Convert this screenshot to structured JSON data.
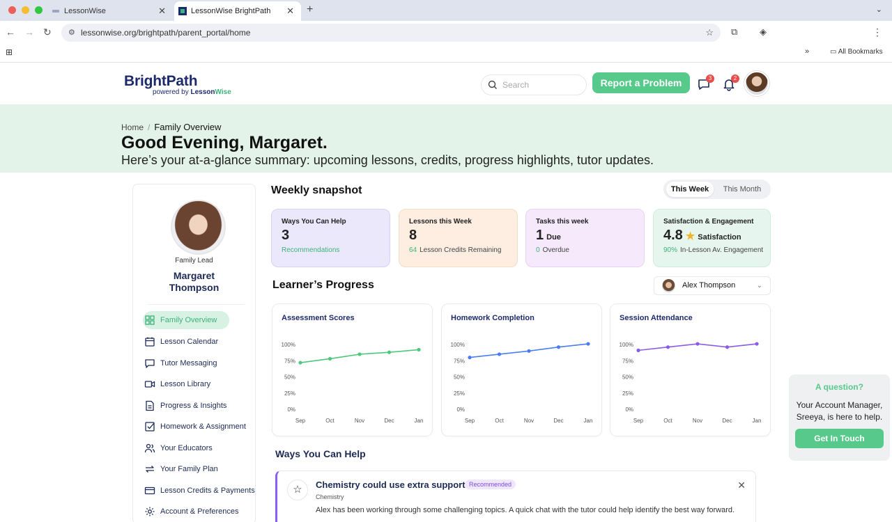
{
  "browser": {
    "tabs": [
      {
        "label": "LessonWise"
      },
      {
        "label": "LessonWise BrightPath"
      }
    ],
    "url": "lessonwise.org/brightpath/parent_portal/home",
    "all_bookmarks": "All Bookmarks"
  },
  "header": {
    "logo_main": "BrightPath",
    "logo_powered": "powered by",
    "logo_lesson": "Lesson",
    "logo_wise": "Wise",
    "search_placeholder": "Search",
    "report_button": "Report a Problem",
    "messages_badge": "3",
    "notifications_badge": "2"
  },
  "hero": {
    "breadcrumb_home": "Home",
    "breadcrumb_sep": "/",
    "breadcrumb_current": "Family Overview",
    "greeting": "Good Evening, Margaret.",
    "subtitle": "Here’s your at-a-glance summary: upcoming lessons, credits, progress highlights, tutor updates."
  },
  "sidebar": {
    "role": "Family Lead",
    "name_first": "Margaret",
    "name_last": "Thompson",
    "items": [
      {
        "label": "Family Overview",
        "icon": "grid-icon",
        "active": true
      },
      {
        "label": "Lesson Calendar",
        "icon": "calendar-icon"
      },
      {
        "label": "Tutor Messaging",
        "icon": "chat-icon"
      },
      {
        "label": "Lesson Library",
        "icon": "video-icon"
      },
      {
        "label": "Progress & Insights",
        "icon": "document-icon"
      },
      {
        "label": "Homework & Assignment",
        "icon": "checkbox-icon"
      },
      {
        "label": "Your Educators",
        "icon": "people-icon"
      },
      {
        "label": "Your Family Plan",
        "icon": "repeat-icon"
      },
      {
        "label": "Lesson Credits & Payments",
        "icon": "card-icon"
      },
      {
        "label": "Account & Preferences",
        "icon": "gear-icon"
      }
    ]
  },
  "snapshot": {
    "title": "Weekly snapshot",
    "toggle_week": "This Week",
    "toggle_month": "This Month",
    "cards": [
      {
        "label": "Ways You Can Help",
        "value": "3",
        "suffix": "",
        "foot_green": "Recommendations",
        "foot": "",
        "bg": "#ebe8fb",
        "border": "#d8d1f5"
      },
      {
        "label": "Lessons this Week",
        "value": "8",
        "suffix": "",
        "foot_green": "64",
        "foot": "Lesson Credits Remaining",
        "bg": "#fdeee1",
        "border": "#f6dcc5"
      },
      {
        "label": "Tasks this week",
        "value": "1",
        "suffix": "Due",
        "foot_green": "0",
        "foot": "Overdue",
        "bg": "#f6e9fb",
        "border": "#ead2f3"
      },
      {
        "label": "Satisfaction & Engagement",
        "value": "4.8",
        "suffix": "Satisfaction",
        "foot_green": "90%",
        "foot": "In-Lesson Av. Engagement",
        "bg": "#e6f6ee",
        "border": "#cdeedc"
      }
    ]
  },
  "progress": {
    "title": "Learner’s Progress",
    "learner": "Alex Thompson"
  },
  "chart_data": [
    {
      "type": "line",
      "title": "Assessment Scores",
      "categories": [
        "Sep",
        "Oct",
        "Nov",
        "Dec",
        "Jan"
      ],
      "values": [
        72,
        78,
        85,
        88,
        92
      ],
      "ylim": [
        0,
        100
      ],
      "yticks": [
        "0%",
        "25%",
        "50%",
        "75%",
        "100%"
      ],
      "color": "#4cc97a"
    },
    {
      "type": "line",
      "title": "Homework Completion",
      "categories": [
        "Sep",
        "Oct",
        "Nov",
        "Dec",
        "Jan"
      ],
      "values": [
        80,
        85,
        90,
        96,
        101
      ],
      "ylim": [
        0,
        100
      ],
      "yticks": [
        "0%",
        "25%",
        "50%",
        "75%",
        "100%"
      ],
      "color": "#4a7df0"
    },
    {
      "type": "line",
      "title": "Session Attendance",
      "categories": [
        "Sep",
        "Oct",
        "Nov",
        "Dec",
        "Jan"
      ],
      "values": [
        91,
        96,
        101,
        96,
        101
      ],
      "ylim": [
        0,
        100
      ],
      "yticks": [
        "0%",
        "25%",
        "50%",
        "75%",
        "100%"
      ],
      "color": "#8a5be6"
    }
  ],
  "help": {
    "section_title": "Ways You Can Help",
    "item_title": "Chemistry could use extra support",
    "item_tag": "Recommended",
    "item_subject": "Chemistry",
    "item_body": "Alex has been working through some challenging topics. A quick chat with the tutor could help identify the best way forward."
  },
  "floating_help": {
    "question": "A question?",
    "text": "Your Account Manager, Sreeya, is here to help.",
    "button": "Get In Touch"
  }
}
